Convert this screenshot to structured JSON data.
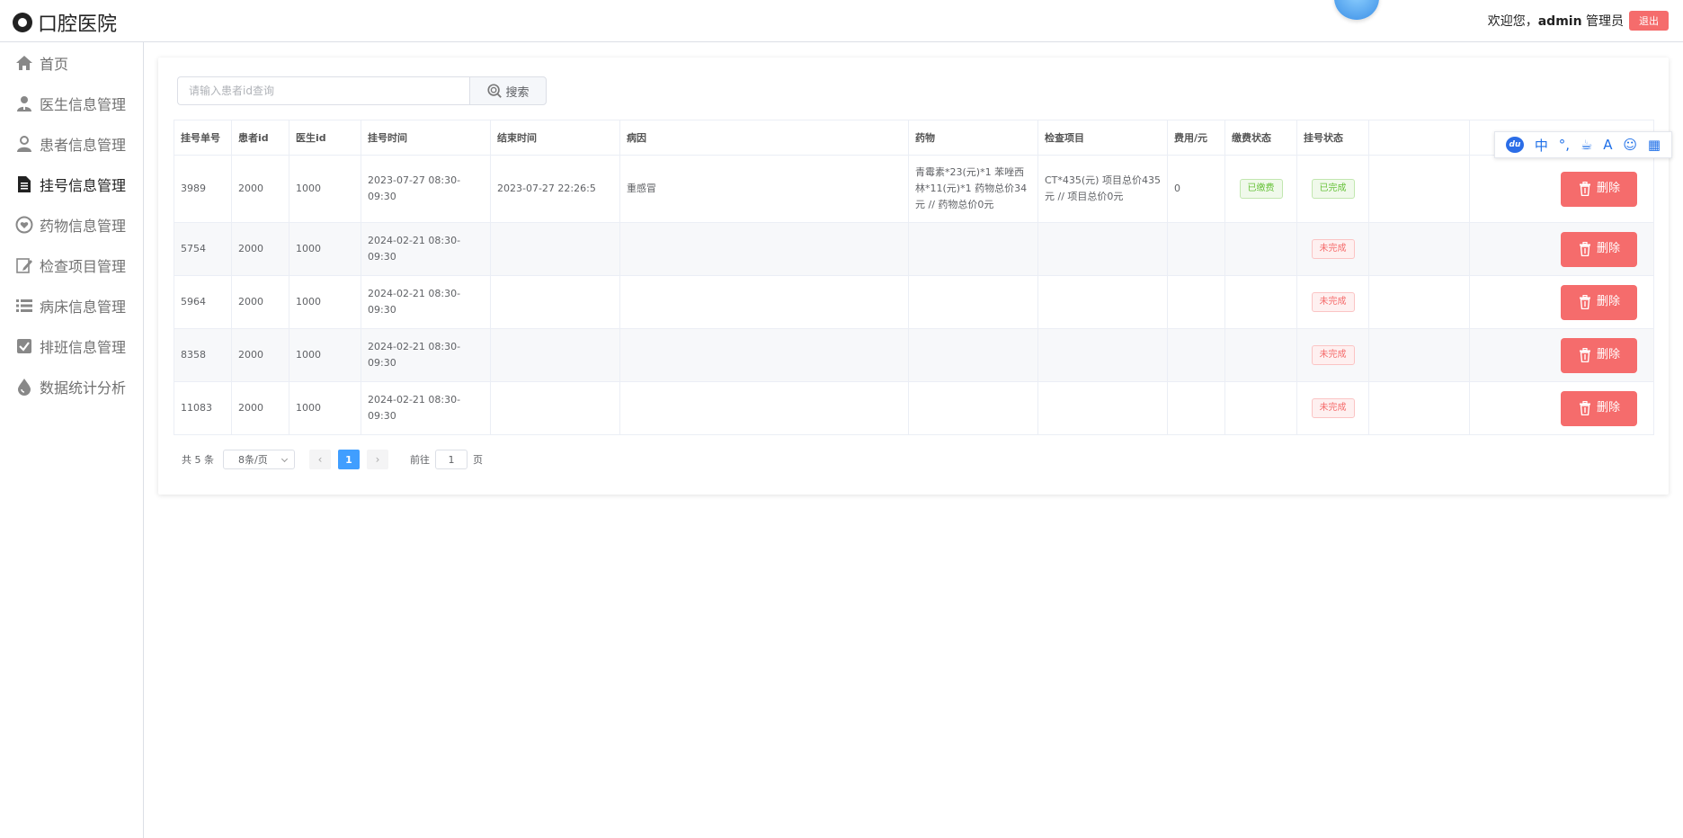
{
  "app": {
    "title": "口腔医院"
  },
  "header": {
    "welcome_prefix": "欢迎您，",
    "username": "admin",
    "role": "管理员",
    "logout_label": "退出"
  },
  "sidebar": {
    "items": [
      {
        "label": "首页",
        "icon": "home-icon"
      },
      {
        "label": "医生信息管理",
        "icon": "doctor-icon"
      },
      {
        "label": "患者信息管理",
        "icon": "user-icon"
      },
      {
        "label": "挂号信息管理",
        "icon": "document-icon",
        "active": true
      },
      {
        "label": "药物信息管理",
        "icon": "medicine-icon"
      },
      {
        "label": "检查项目管理",
        "icon": "edit-icon"
      },
      {
        "label": "病床信息管理",
        "icon": "list-icon"
      },
      {
        "label": "排班信息管理",
        "icon": "checkbox-icon"
      },
      {
        "label": "数据统计分析",
        "icon": "drop-icon"
      }
    ]
  },
  "search": {
    "placeholder": "请输入患者id查询",
    "button_label": "搜索"
  },
  "table": {
    "headers": [
      "挂号单号",
      "患者id",
      "医生id",
      "挂号时间",
      "结束时间",
      "病因",
      "药物",
      "检查项目",
      "费用/元",
      "缴费状态",
      "挂号状态",
      "",
      ""
    ],
    "rows": [
      {
        "id": "3989",
        "patient": "2000",
        "doctor": "1000",
        "reg_time": "2023-07-27 08:30-09:30",
        "end_time": "2023-07-27 22:26:5",
        "cause": "重感冒",
        "drugs": "青霉素*23(元)*1 苯唑西林*11(元)*1 药物总价34元 // 药物总价0元",
        "exams": "CT*435(元) 项目总价435元 // 项目总价0元",
        "fee": "0",
        "pay_status": "已缴费",
        "reg_status": "已完成",
        "delete_label": "删除"
      },
      {
        "id": "5754",
        "patient": "2000",
        "doctor": "1000",
        "reg_time": "2024-02-21 08:30-09:30",
        "end_time": "",
        "cause": "",
        "drugs": "",
        "exams": "",
        "fee": "",
        "pay_status": "",
        "reg_status": "未完成",
        "delete_label": "删除"
      },
      {
        "id": "5964",
        "patient": "2000",
        "doctor": "1000",
        "reg_time": "2024-02-21 08:30-09:30",
        "end_time": "",
        "cause": "",
        "drugs": "",
        "exams": "",
        "fee": "",
        "pay_status": "",
        "reg_status": "未完成",
        "delete_label": "删除"
      },
      {
        "id": "8358",
        "patient": "2000",
        "doctor": "1000",
        "reg_time": "2024-02-21 08:30-09:30",
        "end_time": "",
        "cause": "",
        "drugs": "",
        "exams": "",
        "fee": "",
        "pay_status": "",
        "reg_status": "未完成",
        "delete_label": "删除"
      },
      {
        "id": "11083",
        "patient": "2000",
        "doctor": "1000",
        "reg_time": "2024-02-21 08:30-09:30",
        "end_time": "",
        "cause": "",
        "drugs": "",
        "exams": "",
        "fee": "",
        "pay_status": "",
        "reg_status": "未完成",
        "delete_label": "删除"
      }
    ]
  },
  "pagination": {
    "total": "共 5 条",
    "page_size": "8条/页",
    "current_page": "1",
    "goto_label": "前往",
    "goto_value": "1",
    "page_suffix": "页",
    "prev": "‹",
    "next": "›"
  },
  "ime_toolbar": {
    "logo": "du",
    "lang": "中",
    "items": [
      "°,",
      "☕",
      "A",
      "☺",
      "▦"
    ]
  },
  "colors": {
    "danger": "#f56c6c",
    "primary": "#409eff",
    "success": "#67c23a"
  }
}
